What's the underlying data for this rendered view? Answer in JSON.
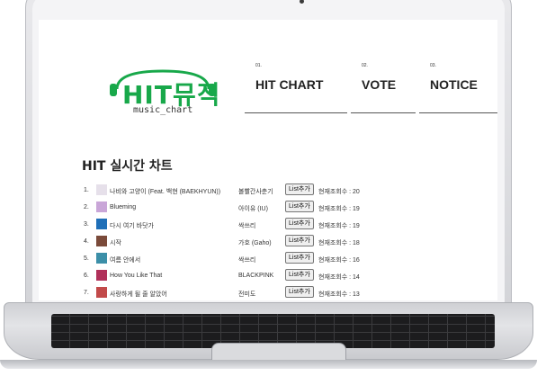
{
  "site": {
    "logo_text": "HIT뮤직",
    "logo_sub": "music_chart",
    "brand_color": "#18a84a"
  },
  "nav": [
    {
      "num": "01.",
      "label": "HIT CHART"
    },
    {
      "num": "02.",
      "label": "VOTE"
    },
    {
      "num": "03.",
      "label": "NOTICE"
    }
  ],
  "chart": {
    "heading": "HIT 실시간 차트",
    "add_label": "List추가",
    "rows": [
      {
        "rank": "1.",
        "title": "나비와 고양이 (Feat. 백현 (BAEKHYUN))",
        "artist": "볼빨간사춘기",
        "views": "현재조회수 : 20",
        "thumb_color": "#e6e0ea"
      },
      {
        "rank": "2.",
        "title": "Blueming",
        "artist": "아이유 (IU)",
        "views": "현재조회수 : 19",
        "thumb_color": "#c9a6d8"
      },
      {
        "rank": "3.",
        "title": "다시 여기 바닷가",
        "artist": "싹쓰리",
        "views": "현재조회수 : 19",
        "thumb_color": "#1f6fb8"
      },
      {
        "rank": "4.",
        "title": "시작",
        "artist": "가호 (Gaho)",
        "views": "현재조회수 : 18",
        "thumb_color": "#7a4a3a"
      },
      {
        "rank": "5.",
        "title": "여름 안에서",
        "artist": "싹쓰리",
        "views": "현재조회수 : 16",
        "thumb_color": "#3c8fa8"
      },
      {
        "rank": "6.",
        "title": "How You Like That",
        "artist": "BLACKPINK",
        "views": "현재조회수 : 14",
        "thumb_color": "#b0305a"
      },
      {
        "rank": "7.",
        "title": "사랑하게 될 줄 알았어",
        "artist": "전미도",
        "views": "현재조회수 : 13",
        "thumb_color": "#c24a4a"
      }
    ]
  }
}
